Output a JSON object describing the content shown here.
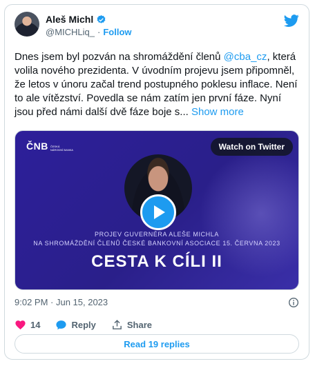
{
  "author": {
    "name": "Aleš Michl",
    "handle": "@MICHLiq_",
    "separator": "·",
    "follow_label": "Follow"
  },
  "tweet": {
    "text_before": "Dnes jsem byl pozván na shromáždění členů ",
    "mention": "@cba_cz",
    "text_after": ", která volila nového prezidenta. V úvodním projevu jsem připomněl, že letos v únoru začal trend postupného poklesu inflace. Není to ale vítězství. Povedla se nám zatím jen první fáze. Nyní jsou před námi další dvě fáze boje s...",
    "show_more": " Show more"
  },
  "media": {
    "logo_main": "ČNB",
    "logo_sub_1": "ČESKÁ",
    "logo_sub_2": "NÁRODNÍ BANKA",
    "watch_label": "Watch on Twitter",
    "caption_line1": "PROJEV GUVERNÉRA ALEŠE MICHLA",
    "caption_line2": "NA SHROMÁŽDĚNÍ ČLENŮ ČESKÉ BANKOVNÍ ASOCIACE 15. ČERVNA 2023",
    "title": "CESTA K CÍLI II"
  },
  "meta": {
    "timestamp": "9:02 PM · Jun 15, 2023"
  },
  "actions": {
    "like_count": "14",
    "reply_label": "Reply",
    "share_label": "Share",
    "read_replies_label": "Read 19 replies"
  },
  "colors": {
    "accent": "#1d9bf0",
    "like": "#f91880",
    "media_bg": "#2d1f9a"
  }
}
